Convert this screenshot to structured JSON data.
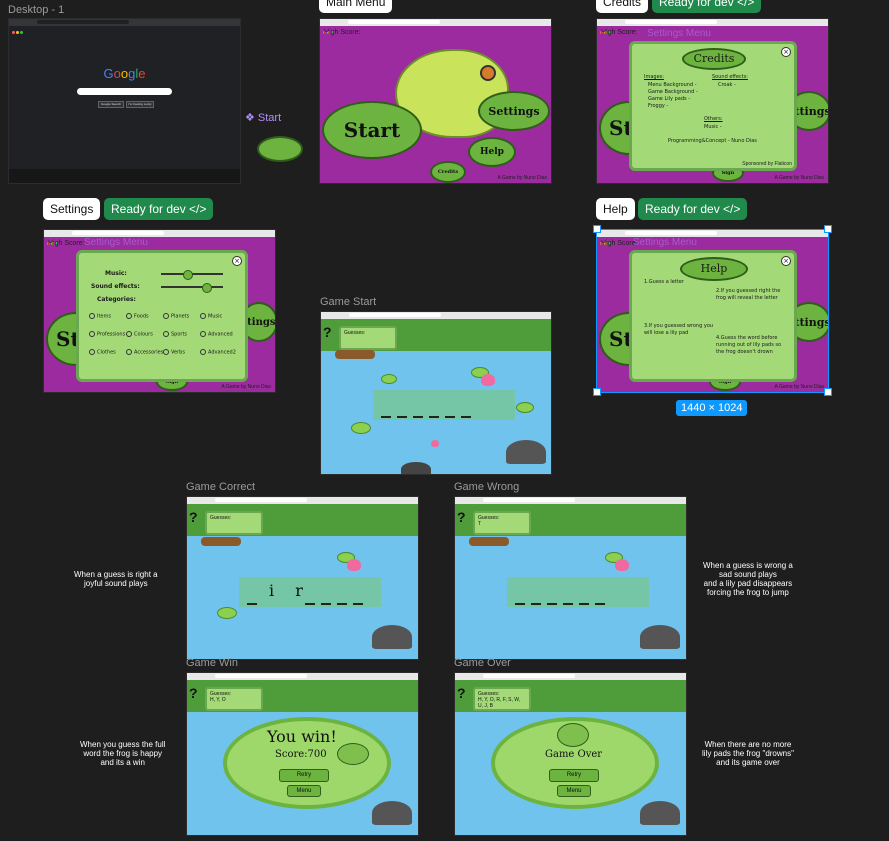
{
  "frames": {
    "desktop": {
      "label": "Desktop - 1",
      "google_logo": "Google",
      "search_button": "Google Search",
      "lucky_button": "I'm Feeling Lucky"
    },
    "main_menu": {
      "label": "Main Menu",
      "high_score": "High Score:",
      "start": "Start",
      "settings": "Settings",
      "help": "Help",
      "credits": "Credits",
      "byline": "A Game by Nuno Dias"
    },
    "credits": {
      "label": "Credits",
      "title": "Credits",
      "images_heading": "Images:",
      "images": [
        "Menu Background -",
        "Game Background -",
        "Game Lily pads -",
        "Froggy -"
      ],
      "sound_heading": "Sound effects:",
      "sound": [
        "Croak -"
      ],
      "others_heading": "Others:",
      "others": [
        "Music -"
      ],
      "programming": "Programming&Concept - Nuno Dias",
      "sponsored": "Sponsored by Flaticon",
      "behind_label": "Settings Menu",
      "behind_start": "St",
      "behind_settings": "ettings",
      "behind_sign": "Sign",
      "high_score": "High Score:",
      "byline": "A Game by Nuno Dias"
    },
    "settings": {
      "label": "Settings",
      "behind_label": "Settings Menu",
      "high_score": "High Score:",
      "music": "Music:",
      "sound_effects": "Sound effects:",
      "music_level": 0.4,
      "sound_level": 0.75,
      "categories_heading": "Categories:",
      "categories": [
        "Items",
        "Foods",
        "Planets",
        "Music",
        "Professions",
        "Colours",
        "Sports",
        "Advanced",
        "Clothes",
        "Accessories",
        "Verbs",
        "Advanced2"
      ],
      "behind_start": "St",
      "behind_settings": "ttings",
      "behind_sign": "Sign",
      "byline": "A Game by Nuno Dias"
    },
    "help": {
      "label": "Help",
      "behind_label": "Settings Menu",
      "high_score": "High Score:",
      "title": "Help",
      "tip1": "1.Guess a letter",
      "tip2": "2.If you guessed right the frog will reveal the letter",
      "tip3": "3.If you guessed wrong you will lose a lily pad",
      "tip4": "4.Guess the word before running out of lily pads so the frog doesn't drown",
      "behind_start": "St",
      "behind_settings": "ettings",
      "behind_sign": "Sign",
      "byline": "A Game by Nuno Dias",
      "dimensions": "1440 × 1024"
    },
    "game_start": {
      "label": "Game Start",
      "guesses": "Guesses:"
    },
    "game_correct": {
      "label": "Game Correct",
      "guesses": "Guesses:",
      "letters": "i r",
      "note": [
        "When a guess is right a",
        "joyful sound plays"
      ]
    },
    "game_wrong": {
      "label": "Game Wrong",
      "guesses": "Guesses:",
      "guessed": "T",
      "note": [
        "When a guess is wrong a",
        "sad sound plays",
        "and a lily pad disappears",
        "forcing the frog to jump"
      ]
    },
    "game_win": {
      "label": "Game Win",
      "guesses": "Guesses:",
      "guessed": "H, Y, O",
      "title": "You win!",
      "score": "Score:700",
      "retry": "Retry",
      "menu": "Menu",
      "note": [
        "When you guess the full",
        "word the frog is happy",
        "and its a win"
      ]
    },
    "game_over": {
      "label": "Game Over",
      "guesses": "Guesses:",
      "guessed": "H, Y, O, R, F, S, W,",
      "guessed2": "U, J, B",
      "title": "Game Over",
      "retry": "Retry",
      "menu": "Menu",
      "note": [
        "When there are no more",
        "lily pads the frog \"drowns\"",
        "and its game over"
      ]
    }
  },
  "chips": {
    "main_menu": "Main Menu",
    "credits": "Credits",
    "settings": "Settings",
    "help": "Help",
    "ready": "Ready for dev"
  },
  "prototype_start": "❖ Start",
  "colors": {
    "canvas": "#1e1e1e",
    "purple": "#9b2b9e",
    "green_chip": "#1f8a4c",
    "selection": "#0d99ff",
    "pond": "#6fc3ec"
  }
}
